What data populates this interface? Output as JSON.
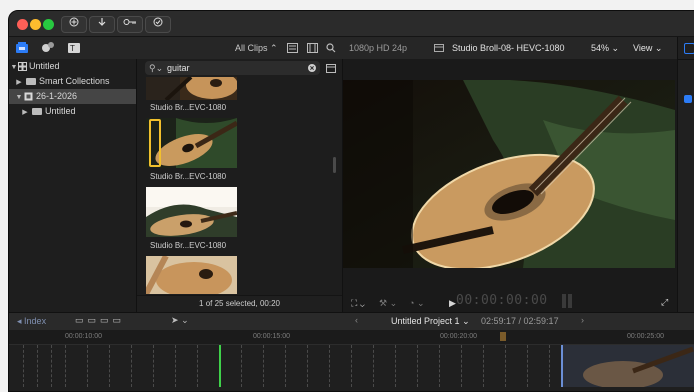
{
  "toolbar": {
    "all_clips_label": "All Clips",
    "format_label": "1080p HD 24p",
    "viewer_clip_title": "Studio Broll-08- HEVC-1080",
    "zoom_label": "54%",
    "view_label": "View"
  },
  "library": {
    "items": [
      {
        "label": "Untitled",
        "indent": 0,
        "triangle": "▼",
        "icon": "library-icon",
        "selected": false
      },
      {
        "label": "Smart Collections",
        "indent": 1,
        "triangle": "▶",
        "icon": "folder-icon",
        "selected": false
      },
      {
        "label": "26-1-2026",
        "indent": 1,
        "triangle": "▼",
        "icon": "event-icon",
        "selected": true
      },
      {
        "label": "Untitled",
        "indent": 2,
        "triangle": "▶",
        "icon": "folder-icon",
        "selected": false
      }
    ]
  },
  "browser": {
    "search_value": "guitar",
    "clips": [
      {
        "label": "Studio Br...EVC-1080"
      },
      {
        "label": "Studio Br...EVC-1080"
      },
      {
        "label": "Studio Br...EVC-1080"
      },
      {
        "label": ""
      }
    ],
    "status": "1 of 25 selected, 00:20"
  },
  "viewer": {
    "timecode": "00:00:00:00"
  },
  "timeline": {
    "index_label": "Index",
    "project_name": "Untitled Project 1",
    "project_duration": "02:59:17 / 02:59:17",
    "ruler_marks": [
      "00:00:10:00",
      "00:00:15:00",
      "00:00:20:00",
      "00:00:25:00"
    ]
  },
  "colors": {
    "accent": "#2c7cf6",
    "selection_yellow": "#f2c02d",
    "playhead": "#3fd14a"
  }
}
